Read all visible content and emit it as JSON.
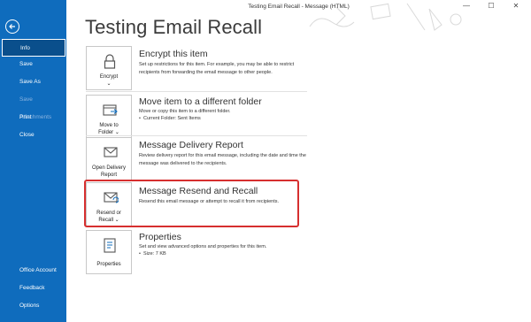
{
  "window": {
    "title": "Testing Email Recall  -  Message (HTML)"
  },
  "sidebar": {
    "items": [
      {
        "label": "Info"
      },
      {
        "label": "Save"
      },
      {
        "label": "Save As"
      },
      {
        "label": "Save Attachments"
      },
      {
        "label": "Print"
      },
      {
        "label": "Close"
      }
    ],
    "bottom": [
      {
        "label": "Office Account"
      },
      {
        "label": "Feedback"
      },
      {
        "label": "Options"
      }
    ]
  },
  "page": {
    "title": "Testing Email Recall"
  },
  "sections": {
    "encrypt": {
      "button_line1": "Encrypt",
      "button_line2": "⌄",
      "title": "Encrypt this item",
      "desc": "Set up restrictions for this item. For example, you may be able to restrict recipients from forwarding the email message to other people."
    },
    "move": {
      "button_line1": "Move to",
      "button_line2": "Folder ⌄",
      "title": "Move item to a different folder",
      "desc": "Move or copy this item to a different folder.",
      "bullet": "Current Folder:  Sent Items"
    },
    "delivery": {
      "button_line1": "Open Delivery",
      "button_line2": "Report",
      "title": "Message Delivery Report",
      "desc": "Review delivery report for this email message, including the date and time the message was delivered to the recipients."
    },
    "resend": {
      "button_line1": "Resend or",
      "button_line2": "Recall ⌄",
      "title": "Message Resend and Recall",
      "desc": "Resend this email message or attempt to recall it from recipients."
    },
    "properties": {
      "button_line1": "Properties",
      "title": "Properties",
      "desc": "Set and view advanced options and properties for this item.",
      "bullet": "Size:    7 KB"
    }
  },
  "colors": {
    "sidebar": "#0f6cbd",
    "highlight": "#d62f2f"
  },
  "icons": [
    "back-arrow-icon",
    "lock-icon",
    "folder-move-icon",
    "mail-report-icon",
    "mail-resend-icon",
    "properties-icon"
  ]
}
